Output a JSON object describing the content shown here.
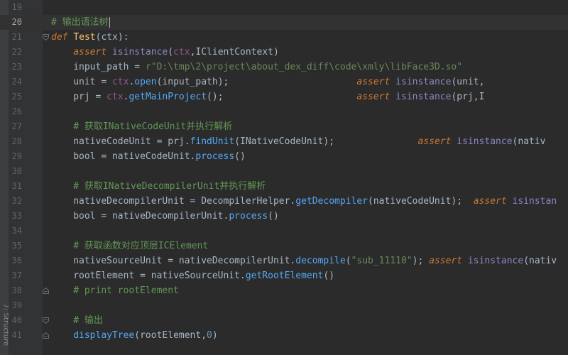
{
  "side_panel": {
    "structure_tab": "7: Structure"
  },
  "lines": [
    {
      "num": "19",
      "indent": 0,
      "tokens": []
    },
    {
      "num": "20",
      "indent": 0,
      "current": true,
      "tokens": [
        {
          "t": "# 输出语法树",
          "c": "cm"
        }
      ]
    },
    {
      "num": "21",
      "indent": 0,
      "fold": "open",
      "tokens": [
        {
          "t": "def",
          "c": "kw-it"
        },
        {
          "t": " "
        },
        {
          "t": "Test",
          "c": "fn"
        },
        {
          "t": "(ctx):"
        }
      ]
    },
    {
      "num": "22",
      "indent": 4,
      "tokens": [
        {
          "t": "assert",
          "c": "kw-it"
        },
        {
          "t": " "
        },
        {
          "t": "isinstance",
          "c": "bi"
        },
        {
          "t": "("
        },
        {
          "t": "ctx",
          "c": "sel"
        },
        {
          "t": ",IClientContext)"
        }
      ]
    },
    {
      "num": "23",
      "indent": 4,
      "tokens": [
        {
          "t": "input_path = "
        },
        {
          "t": "r\"D:\\tmp\\2\\project\\about_dex_diff\\code\\xmly\\libFace3D.so\"",
          "c": "str"
        }
      ]
    },
    {
      "num": "24",
      "indent": 4,
      "tokens": [
        {
          "t": "unit = "
        },
        {
          "t": "ctx",
          "c": "sel"
        },
        {
          "t": "."
        },
        {
          "t": "open",
          "c": "mcall"
        },
        {
          "t": "(input_path);                       "
        },
        {
          "t": "assert",
          "c": "kw-it"
        },
        {
          "t": " "
        },
        {
          "t": "isinstance",
          "c": "bi"
        },
        {
          "t": "(unit,"
        }
      ]
    },
    {
      "num": "25",
      "indent": 4,
      "tokens": [
        {
          "t": "prj = "
        },
        {
          "t": "ctx",
          "c": "sel"
        },
        {
          "t": "."
        },
        {
          "t": "getMainProject",
          "c": "mcall"
        },
        {
          "t": "();                        "
        },
        {
          "t": "assert",
          "c": "kw-it"
        },
        {
          "t": " "
        },
        {
          "t": "isinstance",
          "c": "bi"
        },
        {
          "t": "(prj,I"
        }
      ]
    },
    {
      "num": "26",
      "indent": 0,
      "tokens": []
    },
    {
      "num": "27",
      "indent": 4,
      "tokens": [
        {
          "t": "# 获取INativeCodeUnit并执行解析",
          "c": "cm"
        }
      ]
    },
    {
      "num": "28",
      "indent": 4,
      "tokens": [
        {
          "t": "nativeCodeUnit = prj."
        },
        {
          "t": "findUnit",
          "c": "mcall"
        },
        {
          "t": "(INativeCodeUnit);               "
        },
        {
          "t": "assert",
          "c": "kw-it"
        },
        {
          "t": " "
        },
        {
          "t": "isinstance",
          "c": "bi"
        },
        {
          "t": "(nativ"
        }
      ]
    },
    {
      "num": "29",
      "indent": 4,
      "tokens": [
        {
          "t": "bool = nativeCodeUnit."
        },
        {
          "t": "process",
          "c": "mcall"
        },
        {
          "t": "()"
        }
      ]
    },
    {
      "num": "30",
      "indent": 0,
      "tokens": []
    },
    {
      "num": "31",
      "indent": 4,
      "tokens": [
        {
          "t": "# 获取INativeDecompilerUnit并执行解析",
          "c": "cm"
        }
      ]
    },
    {
      "num": "32",
      "indent": 4,
      "tokens": [
        {
          "t": "nativeDecompilerUnit = DecompilerHelper."
        },
        {
          "t": "getDecompiler",
          "c": "mcall"
        },
        {
          "t": "(nativeCodeUnit);  "
        },
        {
          "t": "assert",
          "c": "kw-it"
        },
        {
          "t": " "
        },
        {
          "t": "isinstan",
          "c": "bi"
        }
      ]
    },
    {
      "num": "33",
      "indent": 4,
      "tokens": [
        {
          "t": "bool = nativeDecompilerUnit."
        },
        {
          "t": "process",
          "c": "mcall"
        },
        {
          "t": "()"
        }
      ]
    },
    {
      "num": "34",
      "indent": 0,
      "tokens": []
    },
    {
      "num": "35",
      "indent": 4,
      "tokens": [
        {
          "t": "# 获取函数对应顶层ICElement",
          "c": "cm"
        }
      ]
    },
    {
      "num": "36",
      "indent": 4,
      "tokens": [
        {
          "t": "nativeSourceUnit = nativeDecompilerUnit."
        },
        {
          "t": "decompile",
          "c": "mcall"
        },
        {
          "t": "("
        },
        {
          "t": "\"sub_11110\"",
          "c": "str"
        },
        {
          "t": "); "
        },
        {
          "t": "assert",
          "c": "kw-it"
        },
        {
          "t": " "
        },
        {
          "t": "isinstance",
          "c": "bi"
        },
        {
          "t": "(nativ"
        }
      ]
    },
    {
      "num": "37",
      "indent": 4,
      "tokens": [
        {
          "t": "rootElement = nativeSourceUnit."
        },
        {
          "t": "getRootElement",
          "c": "mcall"
        },
        {
          "t": "()"
        }
      ]
    },
    {
      "num": "38",
      "indent": 4,
      "fold": "close",
      "tokens": [
        {
          "t": "# print rootElement",
          "c": "cm"
        }
      ]
    },
    {
      "num": "39",
      "indent": 0,
      "tokens": []
    },
    {
      "num": "40",
      "indent": 4,
      "fold": "open",
      "tokens": [
        {
          "t": "# 输出",
          "c": "cm"
        }
      ]
    },
    {
      "num": "41",
      "indent": 4,
      "fold": "close",
      "tokens": [
        {
          "t": "displayTree",
          "c": "mcall"
        },
        {
          "t": "(rootElement,"
        },
        {
          "t": "0",
          "c": "num"
        },
        {
          "t": ")"
        }
      ]
    }
  ]
}
